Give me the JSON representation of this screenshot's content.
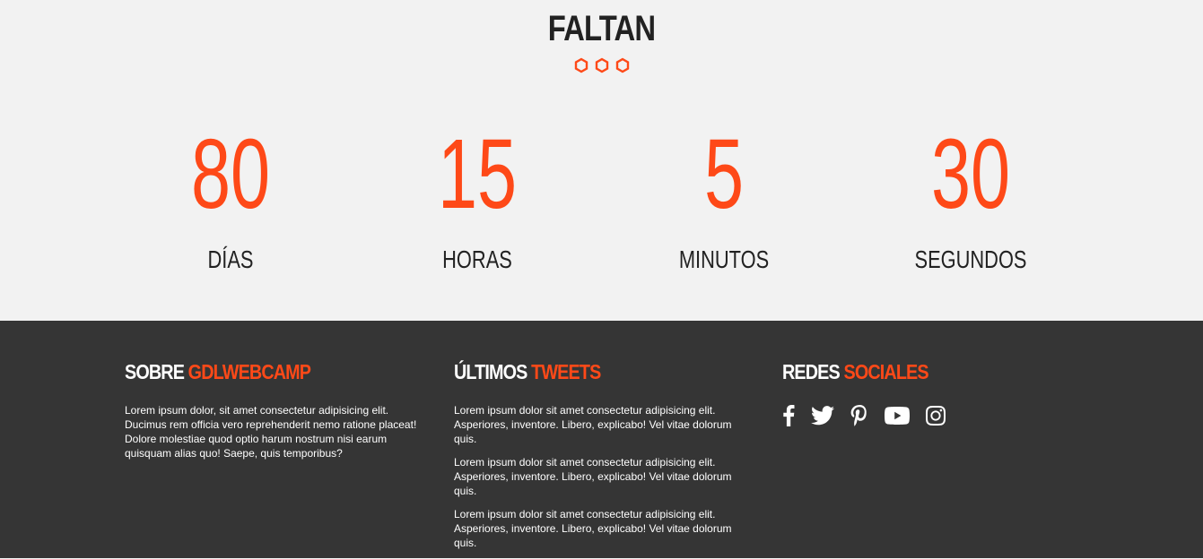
{
  "countdown": {
    "title": "FALTAN",
    "accent_color": "#fe4918",
    "items": [
      {
        "value": "80",
        "label": "DÍAS"
      },
      {
        "value": "15",
        "label": "HORAS"
      },
      {
        "value": "5",
        "label": "MINUTOS"
      },
      {
        "value": "30",
        "label": "SEGUNDOS"
      }
    ]
  },
  "footer": {
    "about": {
      "heading_main": "SOBRE ",
      "heading_accent": "GDLWEBCAMP",
      "text": "Lorem ipsum dolor, sit amet consectetur adipisicing elit. Ducimus rem officia vero reprehenderit nemo ratione placeat! Dolore molestiae quod optio harum nostrum nisi earum quisquam alias quo! Saepe, quis temporibus?"
    },
    "tweets": {
      "heading_main": "ÚLTIMOS ",
      "heading_accent": "TWEETS",
      "items": [
        "Lorem ipsum dolor sit amet consectetur adipisicing elit. Asperiores, inventore. Libero, explicabo! Vel vitae dolorum quis.",
        "Lorem ipsum dolor sit amet consectetur adipisicing elit. Asperiores, inventore. Libero, explicabo! Vel vitae dolorum quis.",
        "Lorem ipsum dolor sit amet consectetur adipisicing elit. Asperiores, inventore. Libero, explicabo! Vel vitae dolorum quis."
      ]
    },
    "social": {
      "heading_main": "REDES ",
      "heading_accent": "SOCIALES",
      "icons": [
        "facebook-icon",
        "twitter-icon",
        "pinterest-icon",
        "youtube-icon",
        "instagram-icon"
      ]
    }
  }
}
